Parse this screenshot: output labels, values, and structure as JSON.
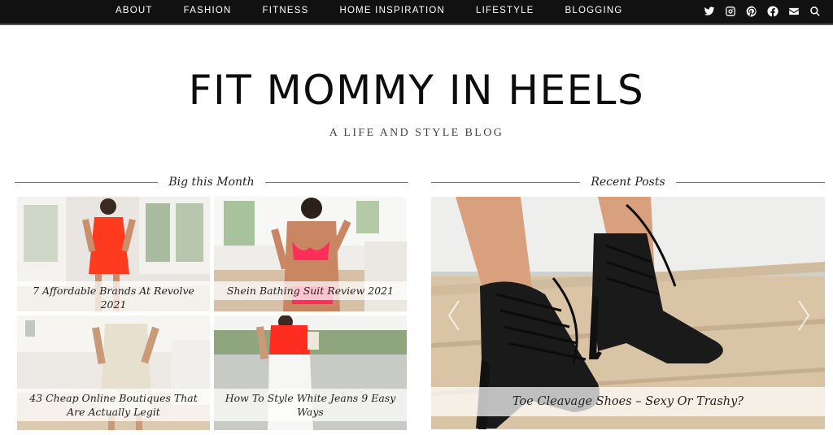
{
  "nav": {
    "items": [
      "ABOUT",
      "FASHION",
      "FITNESS",
      "HOME INSPIRATION",
      "LIFESTYLE",
      "BLOGGING"
    ]
  },
  "social_icons": [
    "twitter-icon",
    "instagram-icon",
    "pinterest-icon",
    "facebook-icon",
    "email-icon",
    "search-icon"
  ],
  "header": {
    "title": "FIT MOMMY IN HEELS",
    "tagline": "A LIFE AND STYLE BLOG"
  },
  "sections": {
    "left_heading": "Big this Month",
    "right_heading": "Recent Posts"
  },
  "grid_posts": [
    {
      "caption": "7 Affordable Brands At Revolve 2021"
    },
    {
      "caption": "Shein Bathing Suit Review 2021"
    },
    {
      "caption": "43 Cheap Online Boutiques That Are Actually Legit"
    },
    {
      "caption": "How To Style White Jeans 9 Easy Ways"
    }
  ],
  "featured_post": {
    "caption": "Toe Cleavage Shoes – Sexy Or Trashy?"
  },
  "colors": {
    "nav_bg": "#111111",
    "accent": "#ff3b1f"
  }
}
